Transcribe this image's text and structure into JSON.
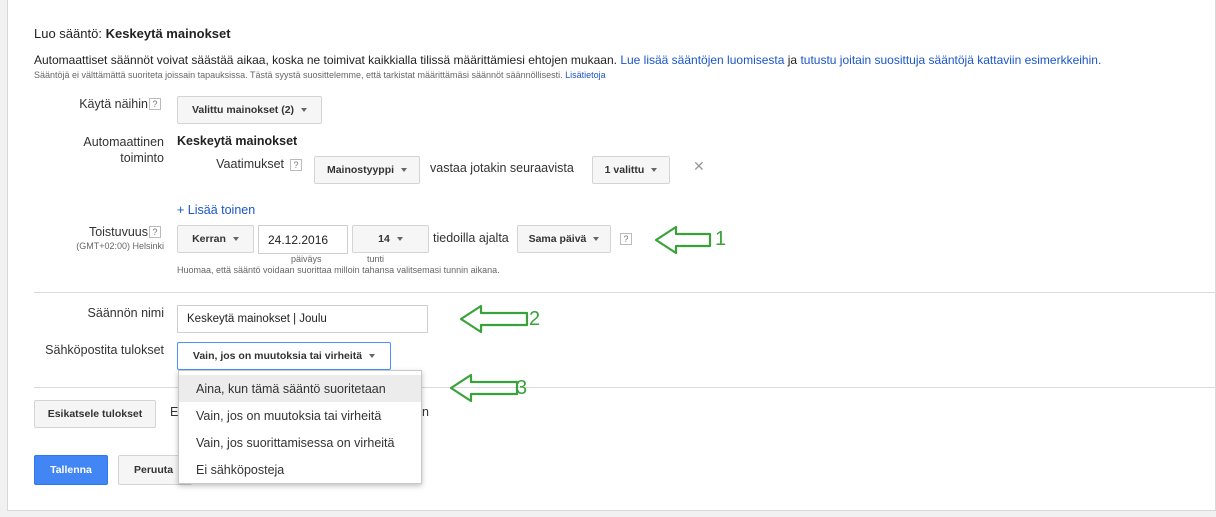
{
  "header": {
    "title_prefix": "Luo sääntö:",
    "title_value": "Keskeytä mainokset",
    "desc_text1": "Automaattiset säännöt voivat säästää aikaa, koska ne toimivat kaikkialla tilissä määrittämiesi ehtojen mukaan.",
    "desc_link1": "Lue lisää sääntöjen luomisesta",
    "desc_text2": "ja",
    "desc_link2": "tutustu joitain suosittuja sääntöjä kattaviin esimerkkeihin.",
    "desc_small": "Sääntöjä ei välttämättä suoriteta joissain tapauksissa. Tästä syystä suosittelemme, että tarkistat määrittämäsi säännöt säännöllisesti.",
    "desc_small_link": "Lisätietoja"
  },
  "apply_to": {
    "label": "Käytä näihin",
    "help": "?",
    "button": "Valittu mainokset (2)"
  },
  "action": {
    "label_line1": "Automaattinen",
    "label_line2": "toiminto",
    "value": "Keskeytä mainokset",
    "req_label": "Vaatimukset",
    "req_help": "?",
    "type_button": "Mainostyyppi",
    "match_text": "vastaa jotakin seuraavista",
    "selected_button": "1 valittu",
    "remove_icon": "✕",
    "add_link": "+ Lisää toinen"
  },
  "frequency": {
    "label": "Toistuvuus",
    "help": "?",
    "timezone": "(GMT+02:00) Helsinki",
    "freq_button": "Kerran",
    "date_value": "24.12.2016",
    "date_caption": "päiväys",
    "hour_button": "14",
    "hour_caption": "tunti",
    "data_text": "tiedoilla ajalta",
    "range_button": "Sama päivä",
    "range_help": "?",
    "note": "Huomaa, että sääntö voidaan suorittaa milloin tahansa valitsemasi tunnin aikana."
  },
  "rule_name": {
    "label": "Säännön nimi",
    "value": "Keskeytä mainokset | Joulu"
  },
  "email": {
    "label": "Sähköpostita tulokset",
    "button": "Vain, jos on muutoksia tai virheitä",
    "options": [
      "Aina, kun tämä sääntö suoritetaan",
      "Vain, jos on muutoksia tai virheitä",
      "Vain, jos suorittamisessa on virheitä",
      "Ei sähköposteja"
    ]
  },
  "footer": {
    "preview_button": "Esikatsele tulokset",
    "preview_text_start": "E",
    "preview_text_end": "n",
    "save_button": "Tallenna",
    "cancel_button": "Peruuta"
  },
  "annotations": {
    "one": "1",
    "two": "2",
    "three": "3"
  },
  "colors": {
    "accent_blue": "#4285f4",
    "link_blue": "#1a55c8",
    "annotation_green": "#3aa23a"
  }
}
